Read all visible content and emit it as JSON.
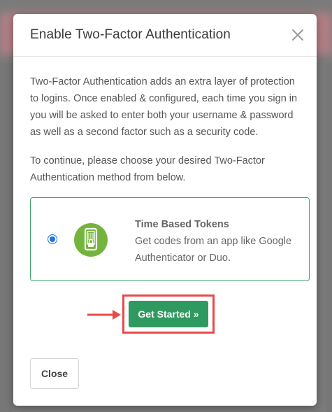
{
  "modal": {
    "title": "Enable Two-Factor Authentication",
    "close_icon": "close-icon",
    "intro_text": "Two-Factor Authentication adds an extra layer of protection to logins. Once enabled & configured, each time you sign in you will be asked to enter both your username & password as well as a second factor such as a security code.",
    "instruction_text": "To continue, please choose your desired Two-Factor Authentication method from below."
  },
  "method": {
    "selected": true,
    "icon": "phone-lock-icon",
    "title": "Time Based Tokens",
    "description": "Get codes from an app like Google Authenticator or Duo."
  },
  "actions": {
    "get_started_label": "Get Started »",
    "close_label": "Close"
  },
  "colors": {
    "accent_green": "#2f9a5f",
    "card_border": "#3aa46b",
    "icon_green": "#74b43d",
    "highlight_red": "#e84a4a",
    "radio_blue": "#1a73e8"
  }
}
